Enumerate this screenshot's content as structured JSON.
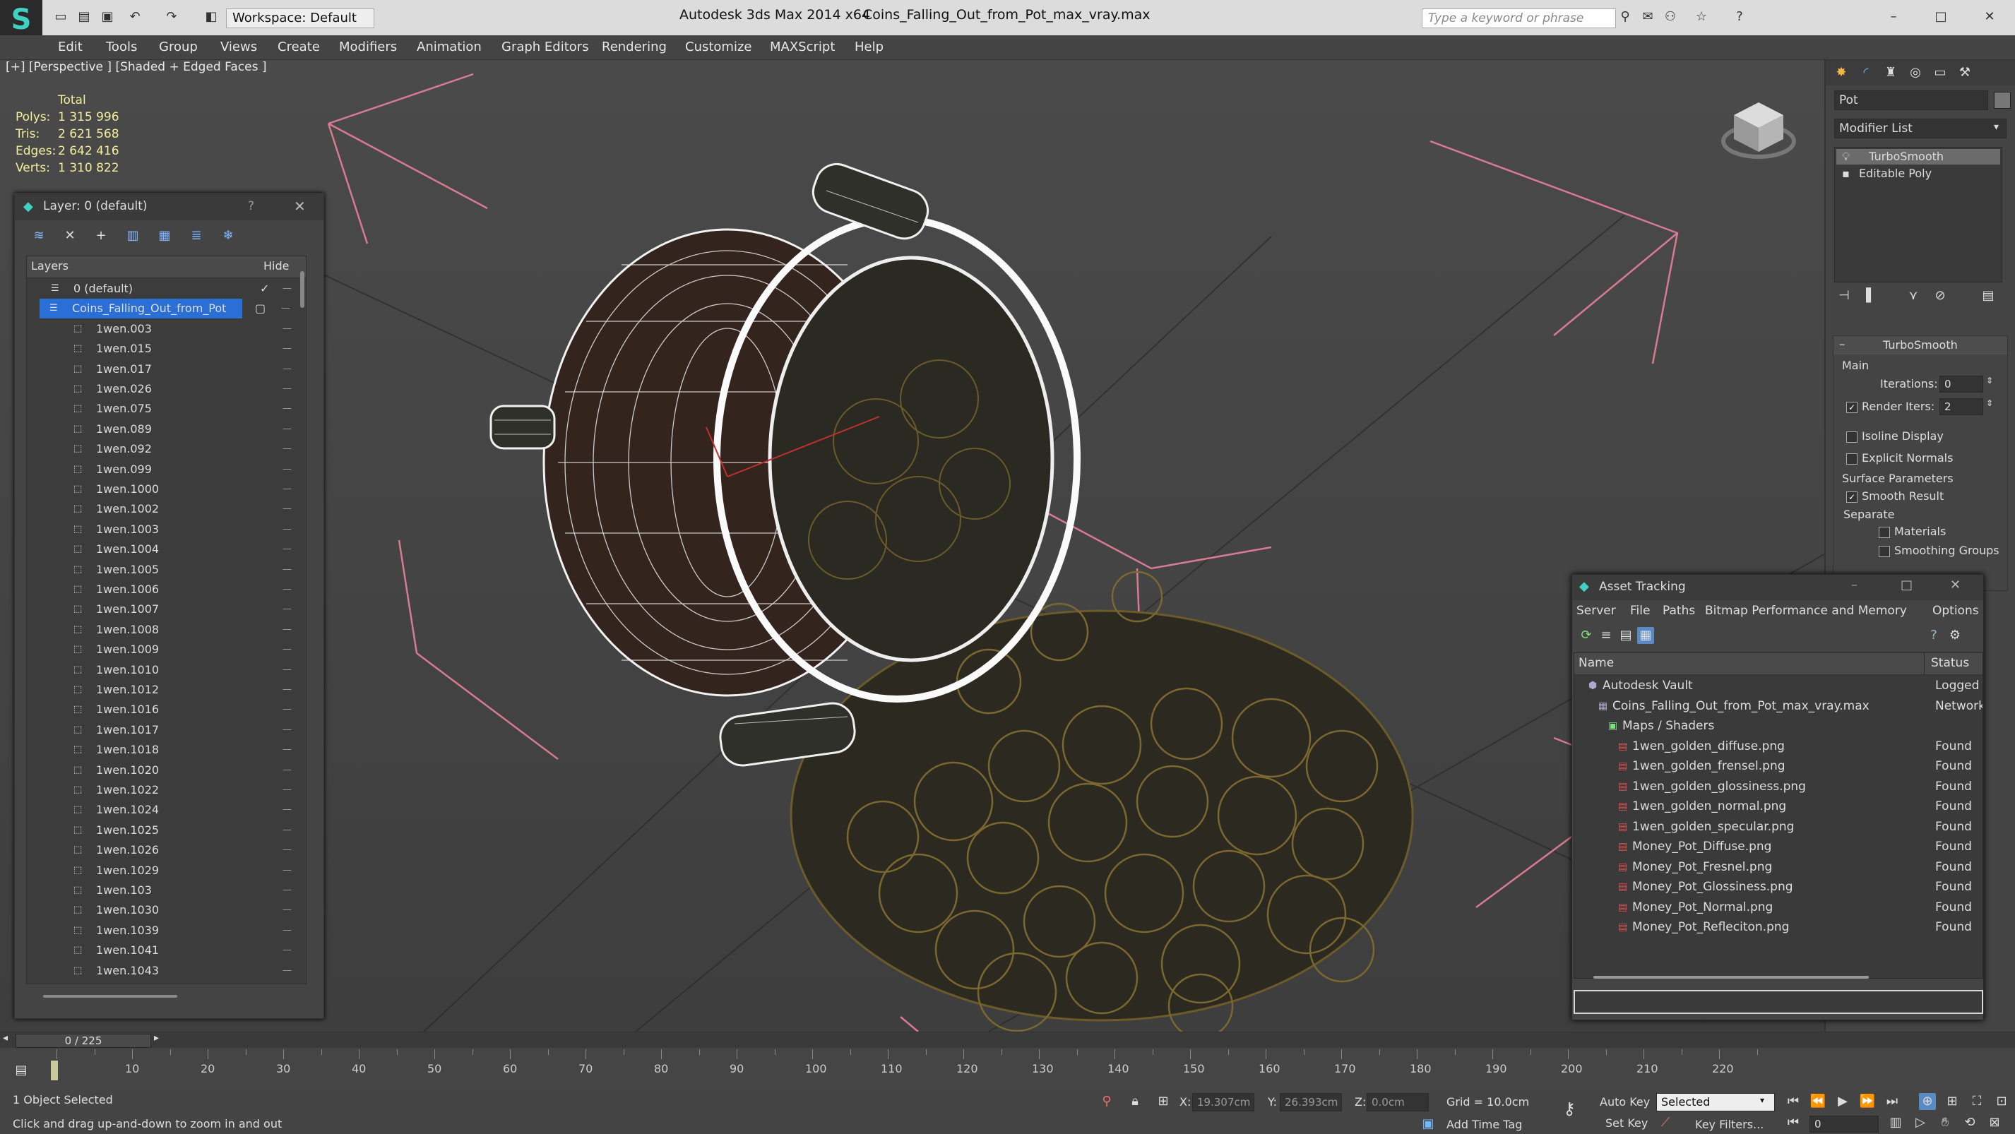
{
  "window": {
    "app_title": "Autodesk 3ds Max  2014 x64",
    "file_title": "Coins_Falling_Out_from_Pot_max_vray.max",
    "workspace": "Workspace: Default",
    "search_placeholder": "Type a keyword or phrase"
  },
  "menu": [
    "Edit",
    "Tools",
    "Group",
    "Views",
    "Create",
    "Modifiers",
    "Animation",
    "Graph Editors",
    "Rendering",
    "Customize",
    "MAXScript",
    "Help"
  ],
  "viewport": {
    "label": "[+] [Perspective ] [Shaded + Edged Faces ]",
    "stats_header": "Total",
    "stats": [
      {
        "label": "Polys:",
        "value": "1 315 996"
      },
      {
        "label": "Tris:",
        "value": "2 621 568"
      },
      {
        "label": "Edges:",
        "value": "2 642 416"
      },
      {
        "label": "Verts:",
        "value": "1 310 822"
      }
    ]
  },
  "layer_window": {
    "title": "Layer: 0 (default)",
    "help": "?",
    "col_layers": "Layers",
    "col_hide": "Hide",
    "rows": [
      "0 (default)",
      "Coins_Falling_Out_from_Pot",
      "1wen.003",
      "1wen.015",
      "1wen.017",
      "1wen.026",
      "1wen.075",
      "1wen.089",
      "1wen.092",
      "1wen.099",
      "1wen.1000",
      "1wen.1002",
      "1wen.1003",
      "1wen.1004",
      "1wen.1005",
      "1wen.1006",
      "1wen.1007",
      "1wen.1008",
      "1wen.1009",
      "1wen.1010",
      "1wen.1012",
      "1wen.1016",
      "1wen.1017",
      "1wen.1018",
      "1wen.1020",
      "1wen.1022",
      "1wen.1024",
      "1wen.1025",
      "1wen.1026",
      "1wen.1029",
      "1wen.103",
      "1wen.1030",
      "1wen.1039",
      "1wen.1041",
      "1wen.1043"
    ]
  },
  "command_panel": {
    "object_name": "Pot",
    "modifier_list": "Modifier List",
    "stack": [
      "TurboSmooth",
      "Editable Poly"
    ],
    "rollout_title": "TurboSmooth",
    "main_label": "Main",
    "iterations_label": "Iterations:",
    "iterations_value": "0",
    "render_iters_label": "Render Iters:",
    "render_iters_value": "2",
    "isoline": "Isoline Display",
    "explicit_normals": "Explicit Normals",
    "surface_params": "Surface Parameters",
    "smooth_result": "Smooth Result",
    "separate": "Separate",
    "materials": "Materials",
    "smoothing_groups": "Smoothing Groups"
  },
  "asset_tracking": {
    "title": "Asset Tracking",
    "menu": [
      "Server",
      "File",
      "Paths",
      "Bitmap Performance and Memory",
      "Options"
    ],
    "col_name": "Name",
    "col_status": "Status",
    "rows": [
      {
        "name": "Autodesk Vault",
        "status": "Logged",
        "indent": 1
      },
      {
        "name": "Coins_Falling_Out_from_Pot_max_vray.max",
        "status": "Network",
        "indent": 2
      },
      {
        "name": "Maps / Shaders",
        "status": "",
        "indent": 3
      },
      {
        "name": "1wen_golden_diffuse.png",
        "status": "Found",
        "indent": 4
      },
      {
        "name": "1wen_golden_frensel.png",
        "status": "Found",
        "indent": 4
      },
      {
        "name": "1wen_golden_glossiness.png",
        "status": "Found",
        "indent": 4
      },
      {
        "name": "1wen_golden_normal.png",
        "status": "Found",
        "indent": 4
      },
      {
        "name": "1wen_golden_specular.png",
        "status": "Found",
        "indent": 4
      },
      {
        "name": "Money_Pot_Diffuse.png",
        "status": "Found",
        "indent": 4
      },
      {
        "name": "Money_Pot_Fresnel.png",
        "status": "Found",
        "indent": 4
      },
      {
        "name": "Money_Pot_Glossiness.png",
        "status": "Found",
        "indent": 4
      },
      {
        "name": "Money_Pot_Normal.png",
        "status": "Found",
        "indent": 4
      },
      {
        "name": "Money_Pot_Refleciton.png",
        "status": "Found",
        "indent": 4
      }
    ]
  },
  "timeline": {
    "frame_counter": "0 / 225",
    "ticks": [
      "10",
      "20",
      "30",
      "40",
      "50",
      "60",
      "70",
      "80",
      "90",
      "100",
      "110",
      "120",
      "130",
      "140",
      "150",
      "160",
      "170",
      "180",
      "190",
      "200",
      "210",
      "220"
    ]
  },
  "status": {
    "selected": "1 Object Selected",
    "prompt": "Click and drag up-and-down to zoom in and out",
    "x_label": "X:",
    "x_value": "19.307cm",
    "y_label": "Y:",
    "y_value": "26.393cm",
    "z_label": "Z:",
    "z_value": "0.0cm",
    "grid": "Grid = 10.0cm",
    "add_time_tag": "Add Time Tag",
    "auto_key": "Auto Key",
    "set_key": "Set Key",
    "selected_dropdown": "Selected",
    "key_filters": "Key Filters...",
    "frame_value": "0"
  }
}
